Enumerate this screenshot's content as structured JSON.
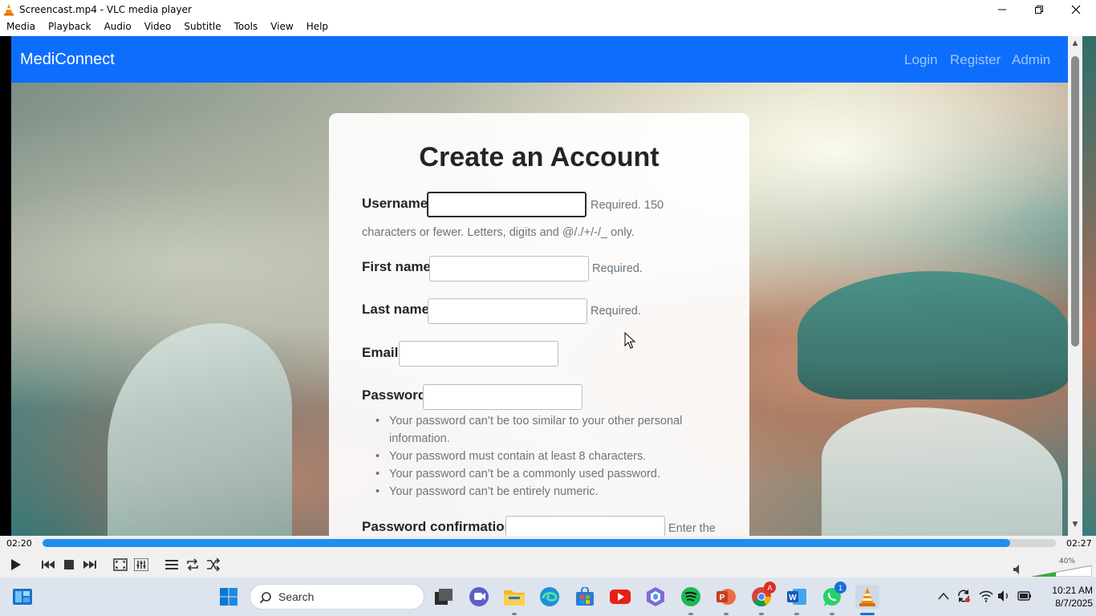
{
  "window": {
    "title": "Screencast.mp4 - VLC media player",
    "minimize_icon": "minimize-icon",
    "maximize_icon": "restore-icon",
    "close_icon": "close-icon"
  },
  "menu": [
    "Media",
    "Playback",
    "Audio",
    "Video",
    "Subtitle",
    "Tools",
    "View",
    "Help"
  ],
  "site": {
    "brand": "MediConnect",
    "nav": [
      "Login",
      "Register",
      "Admin"
    ],
    "nav_color": "#0d6efd"
  },
  "form": {
    "title": "Create an Account",
    "username_label": "Username",
    "username_help_1": "Required. 150",
    "username_help_2": "characters or fewer. Letters, digits and @/./+/-/_ only.",
    "first_name_label": "First name",
    "first_name_help": "Required.",
    "last_name_label": "Last name",
    "last_name_help": "Required.",
    "email_label": "Email",
    "password_label": "Password",
    "password_rules": [
      "Your password can’t be too similar to your other personal",
      "information.",
      "Your password must contain at least 8 characters.",
      "Your password can’t be a commonly used password.",
      "Your password can’t be entirely numeric."
    ],
    "password_confirmation_label": "Password confirmation",
    "password_confirmation_help": "Enter the"
  },
  "player": {
    "elapsed": "02:20",
    "total": "02:27",
    "progress": 0.955,
    "volume": "40%",
    "accent": "#1f8ef1"
  },
  "taskbar": {
    "search_text": "Search",
    "time": "10:21 AM",
    "date": "8/7/2025",
    "chrome_badge": "A",
    "whatsapp_badge": "1"
  }
}
